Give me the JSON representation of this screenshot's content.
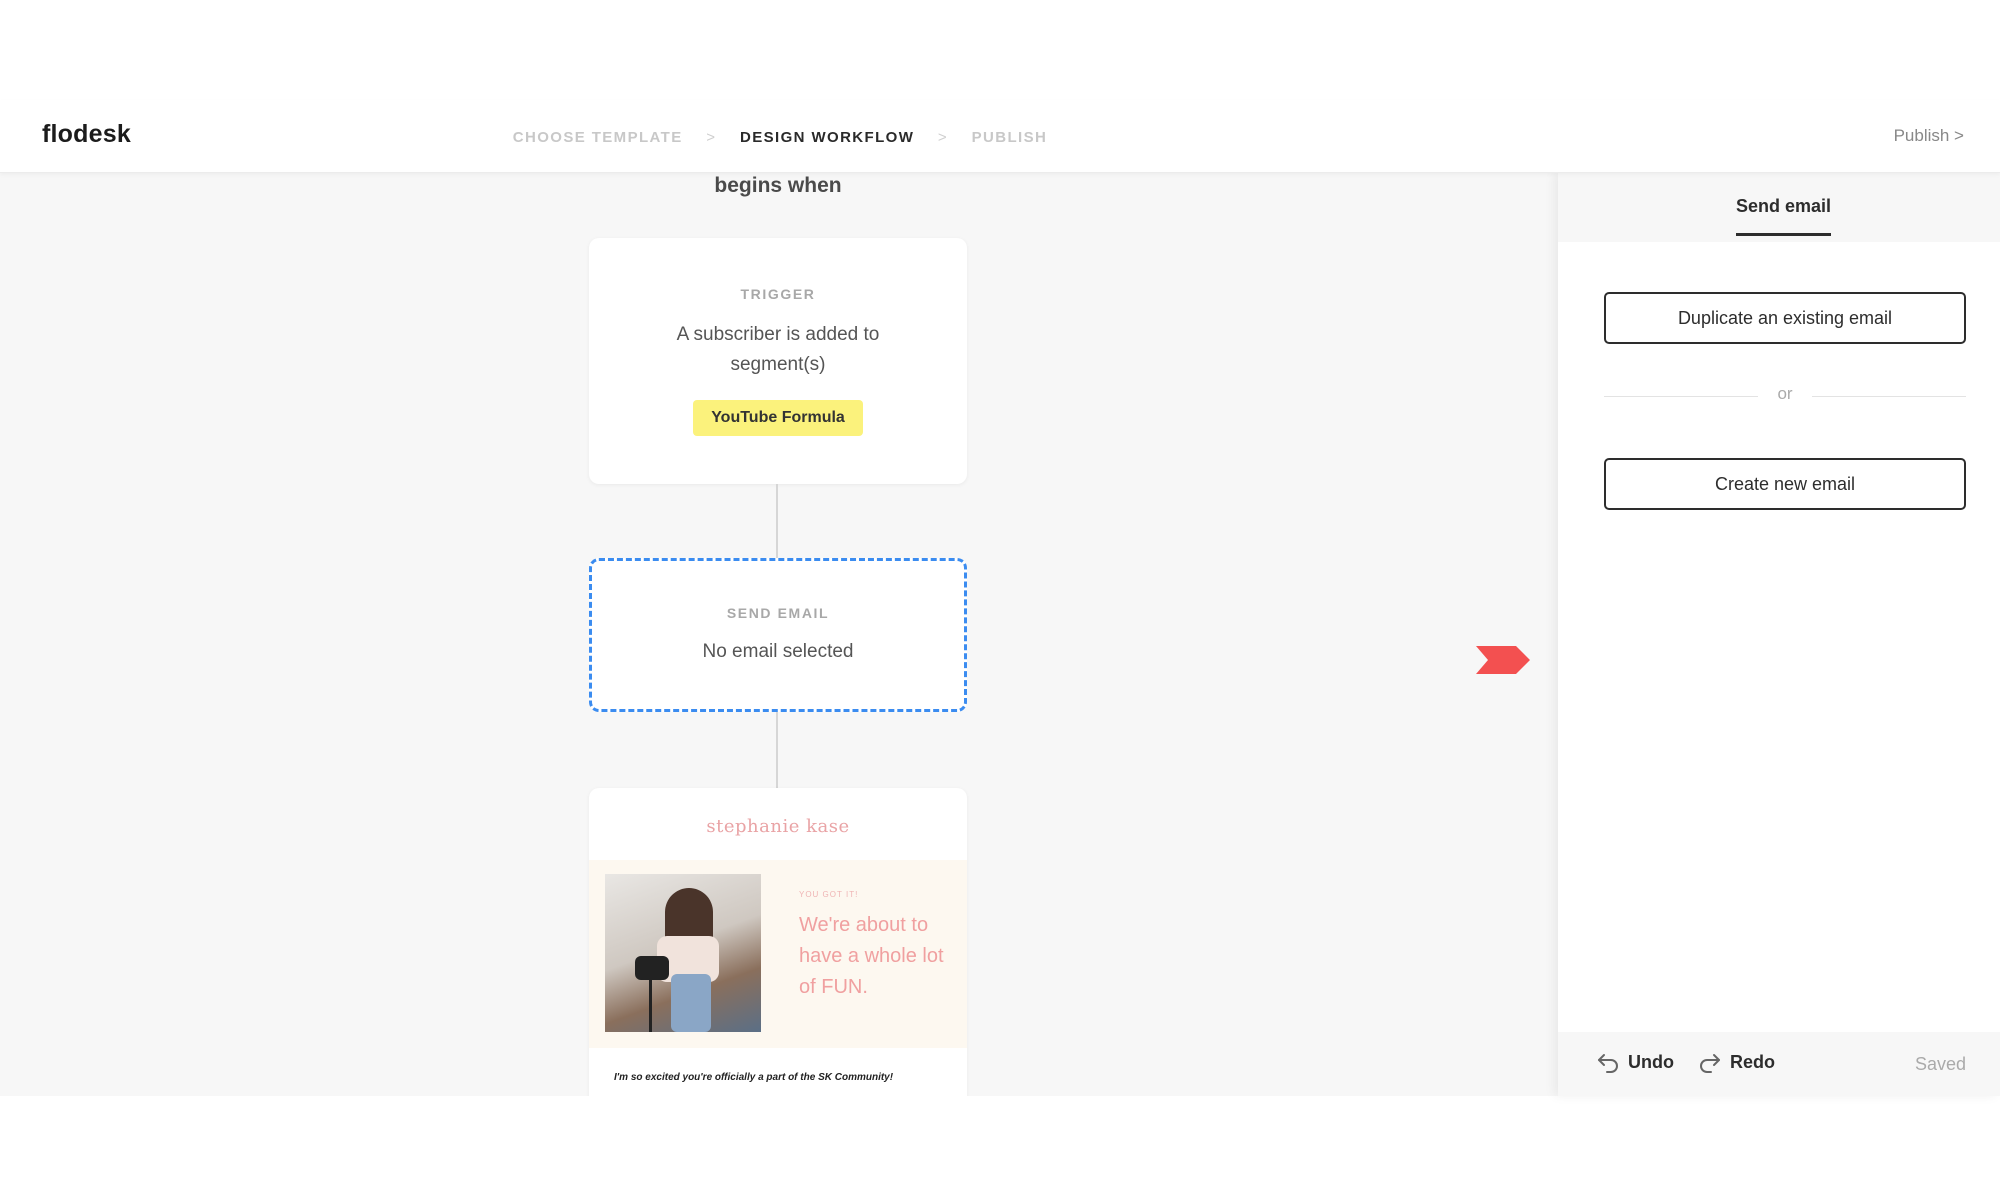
{
  "app": {
    "logo": "flodesk"
  },
  "steps": {
    "choose_template": "CHOOSE TEMPLATE",
    "design_workflow": "DESIGN WORKFLOW",
    "publish": "PUBLISH",
    "separator": ">"
  },
  "header": {
    "publish_link": "Publish >"
  },
  "canvas": {
    "begins_label": "begins when",
    "trigger": {
      "label": "TRIGGER",
      "description": "A subscriber is added to segment(s)",
      "segment_tag": "YouTube Formula"
    },
    "send_email": {
      "label": "SEND EMAIL",
      "status": "No email selected"
    },
    "email_preview": {
      "logo": "stephanie kase",
      "eyebrow": "YOU GOT IT!",
      "headline": "We're about to have a whole lot of FUN.",
      "body": "I'm so excited you're officially a part of the SK Community!"
    }
  },
  "panel": {
    "tab": "Send email",
    "duplicate_button": "Duplicate an existing email",
    "or_text": "or",
    "create_button": "Create new email",
    "footer": {
      "undo": "Undo",
      "redo": "Redo",
      "status": "Saved"
    }
  },
  "colors": {
    "marker": "#f35050",
    "selection_border": "#3b8cf0",
    "segment_tag_bg": "#fbf27c",
    "preview_accent": "#f0a0a0"
  },
  "icons": {
    "undo": "undo-arrow-icon",
    "redo": "redo-arrow-icon",
    "marker": "arrow-marker-icon"
  }
}
